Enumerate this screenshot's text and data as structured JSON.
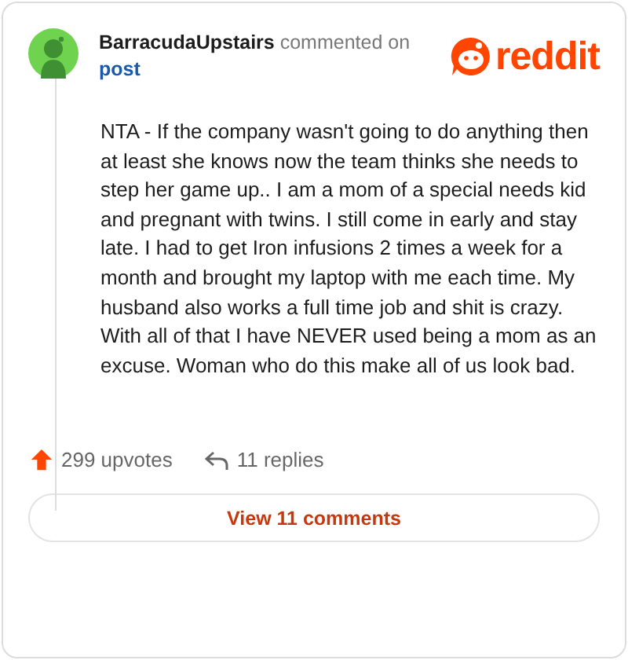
{
  "comment": {
    "author": "BarracudaUpstairs",
    "action": "commented on",
    "target": "post",
    "body": "NTA - If the company wasn't going to do anything then at least she knows now the team thinks she needs to step her game up.. I am a mom of a special needs kid and pregnant with twins. I still come in early and stay late. I had to get Iron infusions 2 times a week for a month and brought my laptop with me each time. My husband also works a full time job and shit is crazy. With all of that I have NEVER used being a mom as an excuse. Woman who do this make all of us look bad."
  },
  "logo": {
    "text": "reddit"
  },
  "stats": {
    "upvotes": "299 upvotes",
    "replies": "11 replies"
  },
  "button": {
    "label": "View 11 comments"
  }
}
